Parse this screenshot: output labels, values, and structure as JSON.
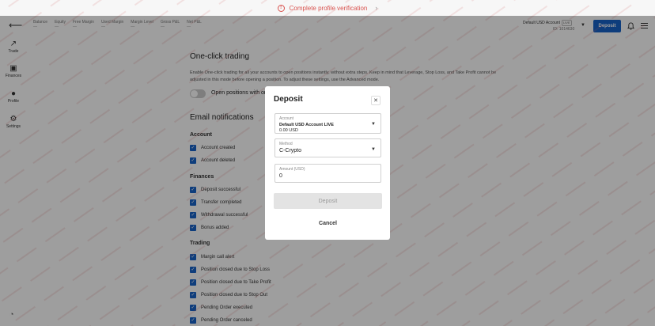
{
  "banner": {
    "text": "Complete profile verification",
    "warn_icon": "!",
    "chevron": "›"
  },
  "header": {
    "stats": [
      {
        "label": "Balance",
        "value": "—"
      },
      {
        "label": "Equity",
        "value": "—"
      },
      {
        "label": "Free Margin",
        "value": "—"
      },
      {
        "label": "Used Margin",
        "value": "—"
      },
      {
        "label": "Margin Level",
        "value": "—"
      },
      {
        "label": "Gross P&L",
        "value": "—"
      },
      {
        "label": "Net P&L",
        "value": "—"
      }
    ],
    "account_name": "Default USD Account",
    "account_badge": "LIVE",
    "account_id": "ID: 1014630",
    "deposit_label": "Deposit"
  },
  "sidebar": {
    "items": [
      {
        "label": "Trade",
        "icon": "↗"
      },
      {
        "label": "Finances",
        "icon": "▣"
      },
      {
        "label": "Profile",
        "icon": "●"
      },
      {
        "label": "Settings",
        "icon": "⚙"
      }
    ]
  },
  "settings": {
    "one_click_title": "One-click trading",
    "one_click_desc": "Enable One-click trading for all your accounts to open positions instantly, without extra steps. Keep in mind that Leverage, Stop Loss, and Take Profit cannot be adjusted in this mode before opening a position. To adjust these settings, use the Advanced mode.",
    "toggle_label": "Open positions with one click",
    "email_title": "Email notifications",
    "sections": [
      {
        "title": "Account",
        "items": [
          "Account created",
          "Account deleted"
        ]
      },
      {
        "title": "Finances",
        "items": [
          "Deposit successful",
          "Transfer completed",
          "Withdrawal successful",
          "Bonus added"
        ]
      },
      {
        "title": "Trading",
        "items": [
          "Margin call alert",
          "Position closed due to Stop Loss",
          "Position closed due to Take Profit",
          "Position closed due to Stop Out",
          "Pending Order executed",
          "Pending Order canceled"
        ]
      }
    ]
  },
  "modal": {
    "title": "Deposit",
    "account_label": "Account",
    "account_value": "Default USD Account LIVE",
    "account_balance": "0.00 USD",
    "method_label": "Method",
    "method_value": "C-Crypto",
    "amount_label": "Amount (USD)",
    "amount_value": "0",
    "deposit_btn": "Deposit",
    "cancel_btn": "Cancel"
  },
  "colors": {
    "accent": "#1763c9",
    "warning": "#d9534f"
  }
}
